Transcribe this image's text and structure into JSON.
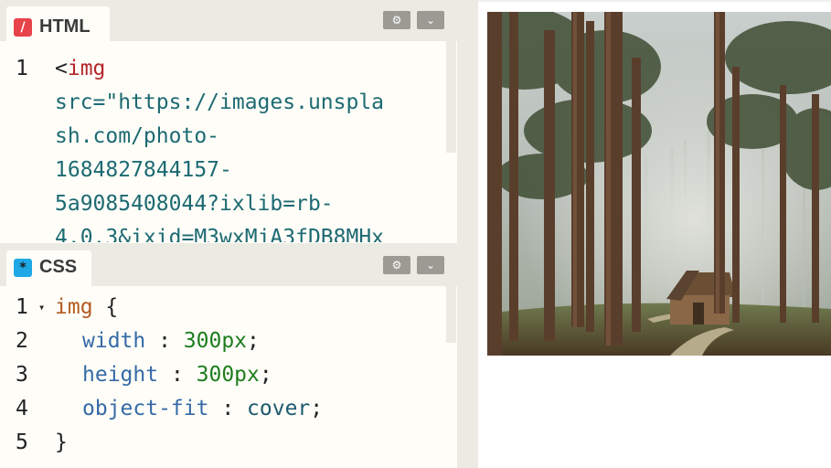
{
  "html_pane": {
    "tab_label": "HTML",
    "tab_icon": "/",
    "icon_color": "#e8424a",
    "lines": [
      {
        "number": "1",
        "tag_open": "<",
        "tag_name": "img"
      },
      {
        "text": "src=\"https://images.unspla"
      },
      {
        "text": "sh.com/photo-"
      },
      {
        "text": "1684827844157-"
      },
      {
        "text": "5a9085408044?ixlib=rb-"
      },
      {
        "text": "4.0.3&ixid=M3wxMjA3fDB8MHx"
      }
    ]
  },
  "css_pane": {
    "tab_label": "CSS",
    "tab_icon": "*",
    "icon_color": "#1ea8e6",
    "lines": [
      {
        "number": "1",
        "fold": "▾",
        "selector": "img",
        "brace": " {"
      },
      {
        "number": "2",
        "prop": "width",
        "colon": " : ",
        "value": "300px",
        "semi": ";"
      },
      {
        "number": "3",
        "prop": "height",
        "colon": " : ",
        "value": "300px",
        "semi": ";"
      },
      {
        "number": "4",
        "prop": "object-fit",
        "colon": " : ",
        "value": "cover",
        "semi": ";"
      },
      {
        "number": "5",
        "brace": "}"
      }
    ]
  },
  "header_buttons": {
    "settings_icon": "gear-icon",
    "collapse_icon": "chevron-down-icon",
    "gear_glyph": "⚙",
    "chevron_glyph": "⌄"
  },
  "preview": {
    "image_subject": "misty pine forest with wooden cabin"
  }
}
